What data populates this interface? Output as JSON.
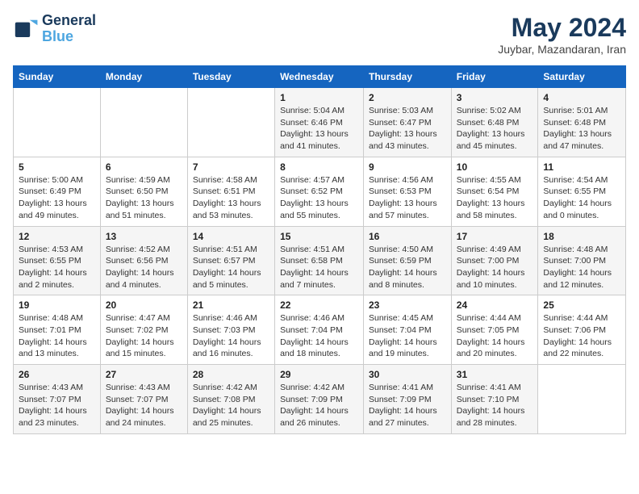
{
  "header": {
    "logo_line1": "General",
    "logo_line2": "Blue",
    "month_title": "May 2024",
    "location": "Juybar, Mazandaran, Iran"
  },
  "weekdays": [
    "Sunday",
    "Monday",
    "Tuesday",
    "Wednesday",
    "Thursday",
    "Friday",
    "Saturday"
  ],
  "weeks": [
    [
      {
        "day": "",
        "info": ""
      },
      {
        "day": "",
        "info": ""
      },
      {
        "day": "",
        "info": ""
      },
      {
        "day": "1",
        "info": "Sunrise: 5:04 AM\nSunset: 6:46 PM\nDaylight: 13 hours\nand 41 minutes."
      },
      {
        "day": "2",
        "info": "Sunrise: 5:03 AM\nSunset: 6:47 PM\nDaylight: 13 hours\nand 43 minutes."
      },
      {
        "day": "3",
        "info": "Sunrise: 5:02 AM\nSunset: 6:48 PM\nDaylight: 13 hours\nand 45 minutes."
      },
      {
        "day": "4",
        "info": "Sunrise: 5:01 AM\nSunset: 6:48 PM\nDaylight: 13 hours\nand 47 minutes."
      }
    ],
    [
      {
        "day": "5",
        "info": "Sunrise: 5:00 AM\nSunset: 6:49 PM\nDaylight: 13 hours\nand 49 minutes."
      },
      {
        "day": "6",
        "info": "Sunrise: 4:59 AM\nSunset: 6:50 PM\nDaylight: 13 hours\nand 51 minutes."
      },
      {
        "day": "7",
        "info": "Sunrise: 4:58 AM\nSunset: 6:51 PM\nDaylight: 13 hours\nand 53 minutes."
      },
      {
        "day": "8",
        "info": "Sunrise: 4:57 AM\nSunset: 6:52 PM\nDaylight: 13 hours\nand 55 minutes."
      },
      {
        "day": "9",
        "info": "Sunrise: 4:56 AM\nSunset: 6:53 PM\nDaylight: 13 hours\nand 57 minutes."
      },
      {
        "day": "10",
        "info": "Sunrise: 4:55 AM\nSunset: 6:54 PM\nDaylight: 13 hours\nand 58 minutes."
      },
      {
        "day": "11",
        "info": "Sunrise: 4:54 AM\nSunset: 6:55 PM\nDaylight: 14 hours\nand 0 minutes."
      }
    ],
    [
      {
        "day": "12",
        "info": "Sunrise: 4:53 AM\nSunset: 6:55 PM\nDaylight: 14 hours\nand 2 minutes."
      },
      {
        "day": "13",
        "info": "Sunrise: 4:52 AM\nSunset: 6:56 PM\nDaylight: 14 hours\nand 4 minutes."
      },
      {
        "day": "14",
        "info": "Sunrise: 4:51 AM\nSunset: 6:57 PM\nDaylight: 14 hours\nand 5 minutes."
      },
      {
        "day": "15",
        "info": "Sunrise: 4:51 AM\nSunset: 6:58 PM\nDaylight: 14 hours\nand 7 minutes."
      },
      {
        "day": "16",
        "info": "Sunrise: 4:50 AM\nSunset: 6:59 PM\nDaylight: 14 hours\nand 8 minutes."
      },
      {
        "day": "17",
        "info": "Sunrise: 4:49 AM\nSunset: 7:00 PM\nDaylight: 14 hours\nand 10 minutes."
      },
      {
        "day": "18",
        "info": "Sunrise: 4:48 AM\nSunset: 7:00 PM\nDaylight: 14 hours\nand 12 minutes."
      }
    ],
    [
      {
        "day": "19",
        "info": "Sunrise: 4:48 AM\nSunset: 7:01 PM\nDaylight: 14 hours\nand 13 minutes."
      },
      {
        "day": "20",
        "info": "Sunrise: 4:47 AM\nSunset: 7:02 PM\nDaylight: 14 hours\nand 15 minutes."
      },
      {
        "day": "21",
        "info": "Sunrise: 4:46 AM\nSunset: 7:03 PM\nDaylight: 14 hours\nand 16 minutes."
      },
      {
        "day": "22",
        "info": "Sunrise: 4:46 AM\nSunset: 7:04 PM\nDaylight: 14 hours\nand 18 minutes."
      },
      {
        "day": "23",
        "info": "Sunrise: 4:45 AM\nSunset: 7:04 PM\nDaylight: 14 hours\nand 19 minutes."
      },
      {
        "day": "24",
        "info": "Sunrise: 4:44 AM\nSunset: 7:05 PM\nDaylight: 14 hours\nand 20 minutes."
      },
      {
        "day": "25",
        "info": "Sunrise: 4:44 AM\nSunset: 7:06 PM\nDaylight: 14 hours\nand 22 minutes."
      }
    ],
    [
      {
        "day": "26",
        "info": "Sunrise: 4:43 AM\nSunset: 7:07 PM\nDaylight: 14 hours\nand 23 minutes."
      },
      {
        "day": "27",
        "info": "Sunrise: 4:43 AM\nSunset: 7:07 PM\nDaylight: 14 hours\nand 24 minutes."
      },
      {
        "day": "28",
        "info": "Sunrise: 4:42 AM\nSunset: 7:08 PM\nDaylight: 14 hours\nand 25 minutes."
      },
      {
        "day": "29",
        "info": "Sunrise: 4:42 AM\nSunset: 7:09 PM\nDaylight: 14 hours\nand 26 minutes."
      },
      {
        "day": "30",
        "info": "Sunrise: 4:41 AM\nSunset: 7:09 PM\nDaylight: 14 hours\nand 27 minutes."
      },
      {
        "day": "31",
        "info": "Sunrise: 4:41 AM\nSunset: 7:10 PM\nDaylight: 14 hours\nand 28 minutes."
      },
      {
        "day": "",
        "info": ""
      }
    ]
  ]
}
